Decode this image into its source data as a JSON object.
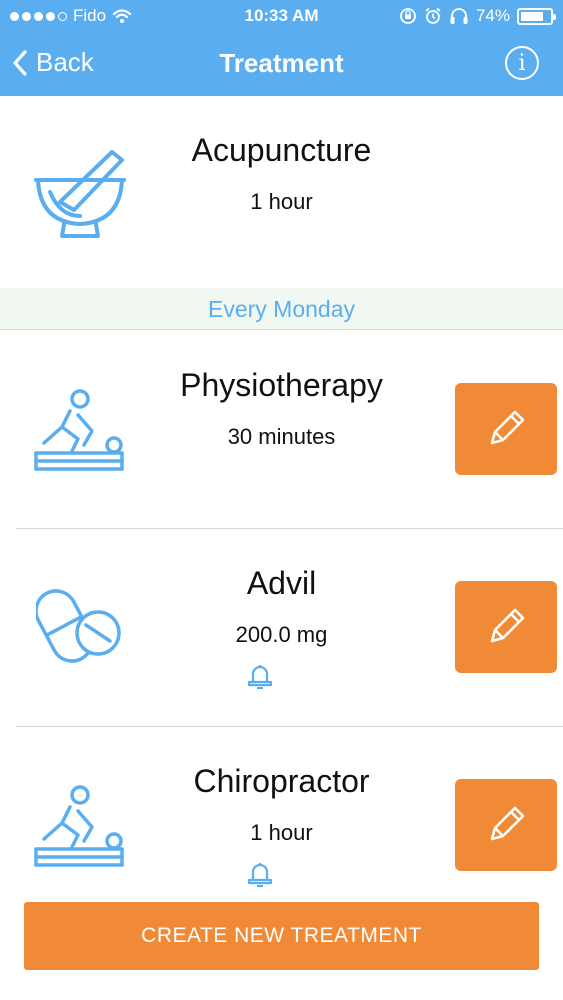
{
  "status_bar": {
    "carrier": "Fido",
    "time": "10:33 AM",
    "battery": "74%"
  },
  "nav": {
    "back_label": "Back",
    "title": "Treatment"
  },
  "header_item": {
    "name": "Acupuncture",
    "detail": "1 hour",
    "icon": "mortar-pestle-icon"
  },
  "section": {
    "label": "Every Monday"
  },
  "items": [
    {
      "name": "Physiotherapy",
      "detail": "30 minutes",
      "icon": "massage-therapy-icon",
      "reminder": false
    },
    {
      "name": "Advil",
      "detail": "200.0 mg",
      "icon": "pill-icon",
      "reminder": true
    },
    {
      "name": "Chiropractor",
      "detail": "1 hour",
      "icon": "massage-therapy-icon",
      "reminder": true
    }
  ],
  "create_button": {
    "label": "CREATE NEW TREATMENT"
  },
  "colors": {
    "primary": "#5aaef0",
    "accent": "#f08a36",
    "section_bg": "#f1f8f1",
    "divider": "#d6d6d6"
  }
}
